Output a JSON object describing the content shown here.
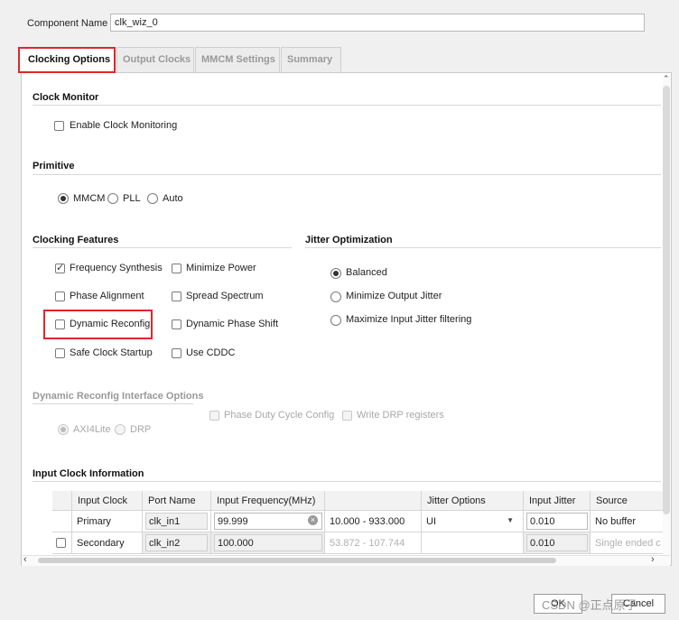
{
  "component": {
    "label": "Component Name",
    "value": "clk_wiz_0"
  },
  "tabs": [
    {
      "label": "Clocking Options"
    },
    {
      "label": "Output Clocks"
    },
    {
      "label": "MMCM Settings"
    },
    {
      "label": "Summary"
    }
  ],
  "clock_monitor": {
    "title": "Clock Monitor",
    "enable_label": "Enable Clock Monitoring"
  },
  "primitive": {
    "title": "Primitive",
    "options": [
      "MMCM",
      "PLL",
      "Auto"
    ],
    "selected": "MMCM"
  },
  "clocking_features": {
    "title": "Clocking Features",
    "items": [
      {
        "label": "Frequency Synthesis",
        "checked": true
      },
      {
        "label": "Minimize Power",
        "checked": false
      },
      {
        "label": "Phase Alignment",
        "checked": false
      },
      {
        "label": "Spread Spectrum",
        "checked": false
      },
      {
        "label": "Dynamic Reconfig",
        "checked": false
      },
      {
        "label": "Dynamic Phase Shift",
        "checked": false
      },
      {
        "label": "Safe Clock Startup",
        "checked": false
      },
      {
        "label": "Use CDDC",
        "checked": false
      }
    ]
  },
  "jitter_optimization": {
    "title": "Jitter Optimization",
    "options": [
      "Balanced",
      "Minimize Output Jitter",
      "Maximize Input Jitter filtering"
    ],
    "selected": "Balanced"
  },
  "dynamic_reconfig": {
    "title": "Dynamic Reconfig Interface Options",
    "checkboxes": [
      "Phase Duty Cycle Config",
      "Write DRP registers"
    ],
    "radios": [
      "AXI4Lite",
      "DRP"
    ],
    "selected": "AXI4Lite"
  },
  "input_clock": {
    "title": "Input Clock Information",
    "headers": [
      "Input Clock",
      "Port Name",
      "Input Frequency(MHz)",
      "",
      "Jitter Options",
      "Input Jitter",
      "Source"
    ],
    "rows": [
      {
        "name": "Primary",
        "port": "clk_in1",
        "freq": "99.999",
        "range": "10.000 - 933.000",
        "jitter_opt": "UI",
        "jitter": "0.010",
        "source": "No buffer"
      },
      {
        "name": "Secondary",
        "port": "clk_in2",
        "freq": "100.000",
        "range": "53.872 - 107.744",
        "jitter_opt": "",
        "jitter": "0.010",
        "source": "Single ended c"
      }
    ]
  },
  "buttons": {
    "ok": "OK",
    "cancel": "Cancel"
  },
  "watermark": "CSDN @正点原子",
  "colors": {
    "highlight": "#e0262c"
  }
}
